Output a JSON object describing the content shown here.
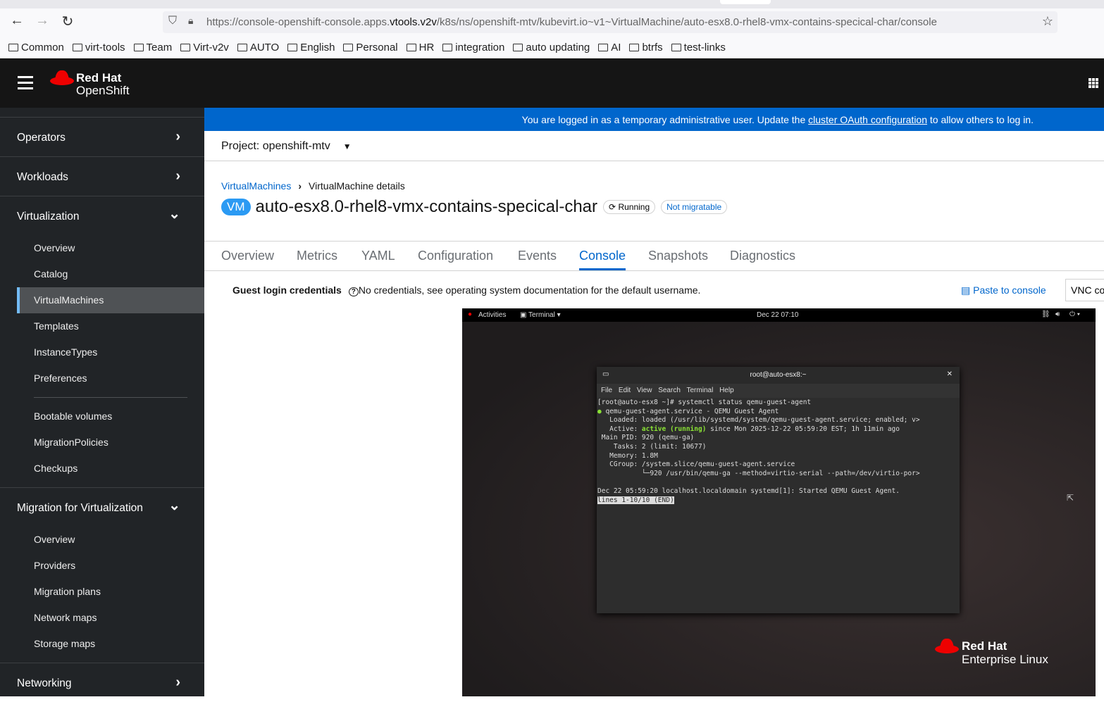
{
  "browser": {
    "url_pre": "https://console-openshift-console.apps.",
    "url_host": "vtools.v2v",
    "url_post": "/k8s/ns/openshift-mtv/kubevirt.io~v1~VirtualMachine/auto-esx8.0-rhel8-vmx-contains-specical-char/console",
    "bookmarks": [
      "Common",
      "virt-tools",
      "Team",
      "Virt-v2v",
      "AUTO",
      "English",
      "Personal",
      "HR",
      "integration",
      "auto updating",
      "AI",
      "btrfs",
      "test-links"
    ]
  },
  "masthead": {
    "brand1": "Red Hat",
    "brand2": "OpenShift"
  },
  "sidebar": {
    "operators": "Operators",
    "workloads": "Workloads",
    "virtualization": "Virtualization",
    "virt_items": [
      "Overview",
      "Catalog",
      "VirtualMachines",
      "Templates",
      "InstanceTypes",
      "Preferences"
    ],
    "virt_items2": [
      "Bootable volumes",
      "MigrationPolicies",
      "Checkups"
    ],
    "migration": "Migration for Virtualization",
    "mig_items": [
      "Overview",
      "Providers",
      "Migration plans",
      "Network maps",
      "Storage maps"
    ],
    "networking": "Networking"
  },
  "banner": {
    "pre": "You are logged in as a temporary administrative user. Update the ",
    "link": "cluster OAuth configuration",
    "post": " to allow others to log in."
  },
  "project": "Project: openshift-mtv",
  "breadcrumb": {
    "parent": "VirtualMachines",
    "current": "VirtualMachine details"
  },
  "vm": {
    "badge": "VM",
    "name": "auto-esx8.0-rhel8-vmx-contains-specical-char",
    "status": "Running",
    "migratable": "Not migratable"
  },
  "tabs": [
    "Overview",
    "Metrics",
    "YAML",
    "Configuration",
    "Events",
    "Console",
    "Snapshots",
    "Diagnostics"
  ],
  "creds": {
    "label": "Guest login credentials",
    "text": "No credentials, see operating system documentation for the default username."
  },
  "paste": "Paste to console",
  "vnc": "VNC console",
  "guest": {
    "activities": "Activities",
    "terminal_menu": "Terminal",
    "clock": "Dec 22 07:10",
    "term_title": "root@auto-esx8:~",
    "menu": [
      "File",
      "Edit",
      "View",
      "Search",
      "Terminal",
      "Help"
    ],
    "lines": [
      "[root@auto-esx8 ~]# systemctl status qemu-guest-agent",
      "● qemu-guest-agent.service - QEMU Guest Agent",
      "   Loaded: loaded (/usr/lib/systemd/system/qemu-guest-agent.service; enabled; v>",
      "   Active: ",
      "active (running)",
      " since Mon 2025-12-22 05:59:20 EST; 1h 11min ago",
      " Main PID: 920 (qemu-ga)",
      "    Tasks: 2 (limit: 10677)",
      "   Memory: 1.8M",
      "   CGroup: /system.slice/qemu-guest-agent.service",
      "           └─920 /usr/bin/qemu-ga --method=virtio-serial --path=/dev/virtio-por>",
      "",
      "Dec 22 05:59:20 localhost.localdomain systemd[1]: Started QEMU Guest Agent.",
      "lines 1-10/10 (END)"
    ],
    "rhel1": "Red Hat",
    "rhel2": "Enterprise Linux"
  }
}
